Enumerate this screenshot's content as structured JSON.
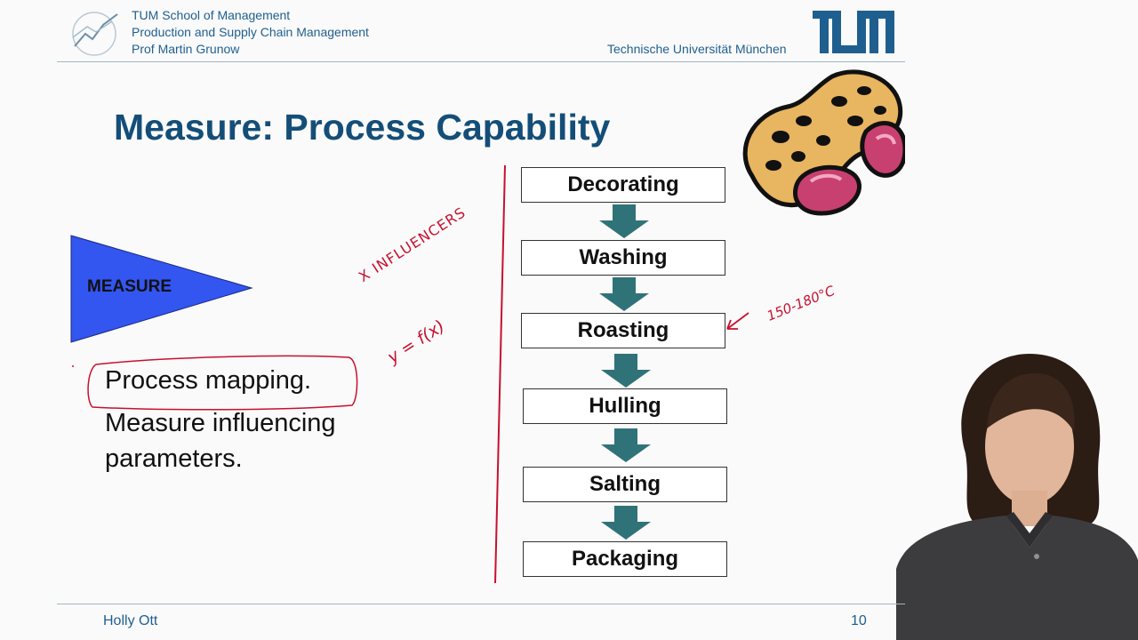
{
  "header": {
    "school": "TUM School of Management",
    "chair": "Production and Supply Chain Management",
    "professor": "Prof Martin Grunow",
    "university": "Technische Universität München",
    "logo_text": "TUM"
  },
  "slide": {
    "title": "Measure: Process Capability",
    "phase_label": "MEASURE",
    "bullets": [
      "Process mapping.",
      "Measure influencing",
      "parameters."
    ],
    "process_steps": [
      "Decorating",
      "Washing",
      "Roasting",
      "Hulling",
      "Salting",
      "Packaging"
    ]
  },
  "annotations": {
    "x_influencers": "X INFLUENCERS",
    "formula": "y = f(x)",
    "temperature": "150-180°C"
  },
  "footer": {
    "presenter": "Holly Ott",
    "page_number": "10"
  },
  "colors": {
    "brand_blue": "#1f5f8f",
    "title_blue": "#144e78",
    "triangle_blue": "#3355f0",
    "arrow_teal": "#2f7378",
    "ink_red": "#c8102e"
  }
}
